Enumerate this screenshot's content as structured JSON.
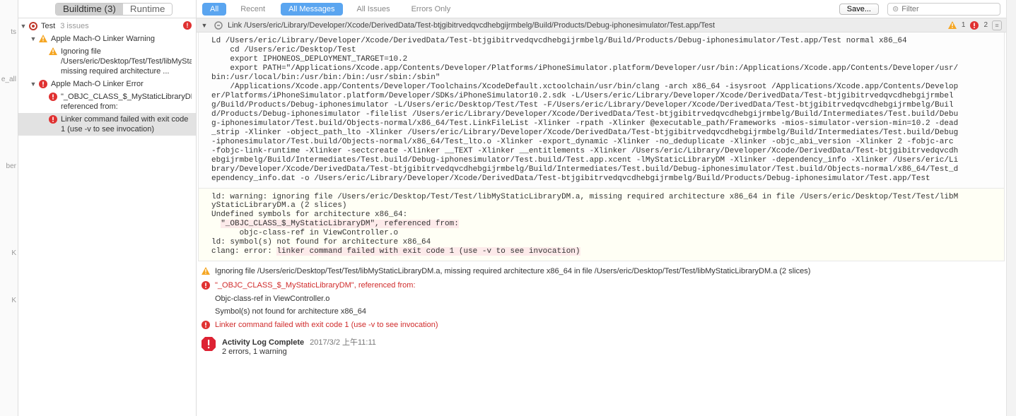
{
  "leftstrip_items": [
    "ts",
    "e_all",
    "",
    "ber",
    "",
    "K",
    "K"
  ],
  "sidebar": {
    "tabs": {
      "buildtime": "Buildtime (3)",
      "runtime": "Runtime"
    },
    "root": {
      "label": "Test",
      "count_label": "3 issues"
    },
    "nodes": [
      {
        "label": "Apple Mach-O Linker Warning"
      },
      {
        "text": "Ignoring file /Users/eric/Desktop/Test/Test/libMyStaticLibraryDM.a, missing required architecture ..."
      },
      {
        "label": "Apple Mach-O Linker Error"
      },
      {
        "text": "\"_OBJC_CLASS_$_MyStaticLibraryDM\", referenced from:"
      },
      {
        "text": "Linker command failed with exit code 1 (use -v to see invocation)"
      }
    ]
  },
  "toolbar": {
    "scope_all": "All",
    "scope_recent": "Recent",
    "msg_all": "All Messages",
    "msg_issues": "All Issues",
    "msg_errors": "Errors Only",
    "save": "Save...",
    "filter_placeholder": "Filter"
  },
  "headerbar": {
    "title": "Link /Users/eric/Library/Developer/Xcode/DerivedData/Test-btjgibitrvedqvcdhebgijrmbelg/Build/Products/Debug-iphonesimulator/Test.app/Test",
    "warn_count": "1",
    "err_count": "2"
  },
  "code1": "Ld /Users/eric/Library/Developer/Xcode/DerivedData/Test-btjgibitrvedqvcdhebgijrmbelg/Build/Products/Debug-iphonesimulator/Test.app/Test normal x86_64\n    cd /Users/eric/Desktop/Test\n    export IPHONEOS_DEPLOYMENT_TARGET=10.2\n    export PATH=\"/Applications/Xcode.app/Contents/Developer/Platforms/iPhoneSimulator.platform/Developer/usr/bin:/Applications/Xcode.app/Contents/Developer/usr/bin:/usr/local/bin:/usr/bin:/bin:/usr/sbin:/sbin\"\n    /Applications/Xcode.app/Contents/Developer/Toolchains/XcodeDefault.xctoolchain/usr/bin/clang -arch x86_64 -isysroot /Applications/Xcode.app/Contents/Developer/Platforms/iPhoneSimulator.platform/Developer/SDKs/iPhoneSimulator10.2.sdk -L/Users/eric/Library/Developer/Xcode/DerivedData/Test-btjgibitrvedqvcdhebgijrmbelg/Build/Products/Debug-iphonesimulator -L/Users/eric/Desktop/Test/Test -F/Users/eric/Library/Developer/Xcode/DerivedData/Test-btjgibitrvedqvcdhebgijrmbelg/Build/Products/Debug-iphonesimulator -filelist /Users/eric/Library/Developer/Xcode/DerivedData/Test-btjgibitrvedqvcdhebgijrmbelg/Build/Intermediates/Test.build/Debug-iphonesimulator/Test.build/Objects-normal/x86_64/Test.LinkFileList -Xlinker -rpath -Xlinker @executable_path/Frameworks -mios-simulator-version-min=10.2 -dead_strip -Xlinker -object_path_lto -Xlinker /Users/eric/Library/Developer/Xcode/DerivedData/Test-btjgibitrvedqvcdhebgijrmbelg/Build/Intermediates/Test.build/Debug-iphonesimulator/Test.build/Objects-normal/x86_64/Test_lto.o -Xlinker -export_dynamic -Xlinker -no_deduplicate -Xlinker -objc_abi_version -Xlinker 2 -fobjc-arc -fobjc-link-runtime -Xlinker -sectcreate -Xlinker __TEXT -Xlinker __entitlements -Xlinker /Users/eric/Library/Developer/Xcode/DerivedData/Test-btjgibitrvedqvcdhebgijrmbelg/Build/Intermediates/Test.build/Debug-iphonesimulator/Test.build/Test.app.xcent -lMyStaticLibraryDM -Xlinker -dependency_info -Xlinker /Users/eric/Library/Developer/Xcode/DerivedData/Test-btjgibitrvedqvcdhebgijrmbelg/Build/Intermediates/Test.build/Debug-iphonesimulator/Test.build/Objects-normal/x86_64/Test_dependency_info.dat -o /Users/eric/Library/Developer/Xcode/DerivedData/Test-btjgibitrvedqvcdhebgijrmbelg/Build/Products/Debug-iphonesimulator/Test.app/Test",
  "code2_pre": "ld: warning: ignoring file /Users/eric/Desktop/Test/Test/libMyStaticLibraryDM.a, missing required architecture x86_64 in file /Users/eric/Desktop/Test/Test/libMyStaticLibraryDM.a (2 slices)\nUndefined symbols for architecture x86_64:\n  ",
  "code2_hl1": "\"_OBJC_CLASS_$_MyStaticLibraryDM\", referenced from:",
  "code2_mid": "\n      objc-class-ref in ViewController.o\nld: symbol(s) not found for architecture x86_64\nclang: error: ",
  "code2_hl2": "linker command failed with exit code 1 (use -v to see invocation)",
  "flat": [
    {
      "type": "warn",
      "text": "Ignoring file /Users/eric/Desktop/Test/Test/libMyStaticLibraryDM.a, missing required architecture x86_64 in file /Users/eric/Desktop/Test/Test/libMyStaticLibraryDM.a (2 slices)"
    },
    {
      "type": "err",
      "text": "\"_OBJC_CLASS_$_MyStaticLibraryDM\", referenced from:",
      "red": true
    },
    {
      "type": "none",
      "text": "Objc-class-ref in ViewController.o"
    },
    {
      "type": "none",
      "text": "Symbol(s) not found for architecture x86_64"
    },
    {
      "type": "err",
      "text": "Linker command failed with exit code 1 (use -v to see invocation)",
      "red": true
    }
  ],
  "complete": {
    "title": "Activity Log Complete",
    "timestamp": "2017/3/2 上午11:11",
    "summary": "2 errors, 1 warning"
  }
}
